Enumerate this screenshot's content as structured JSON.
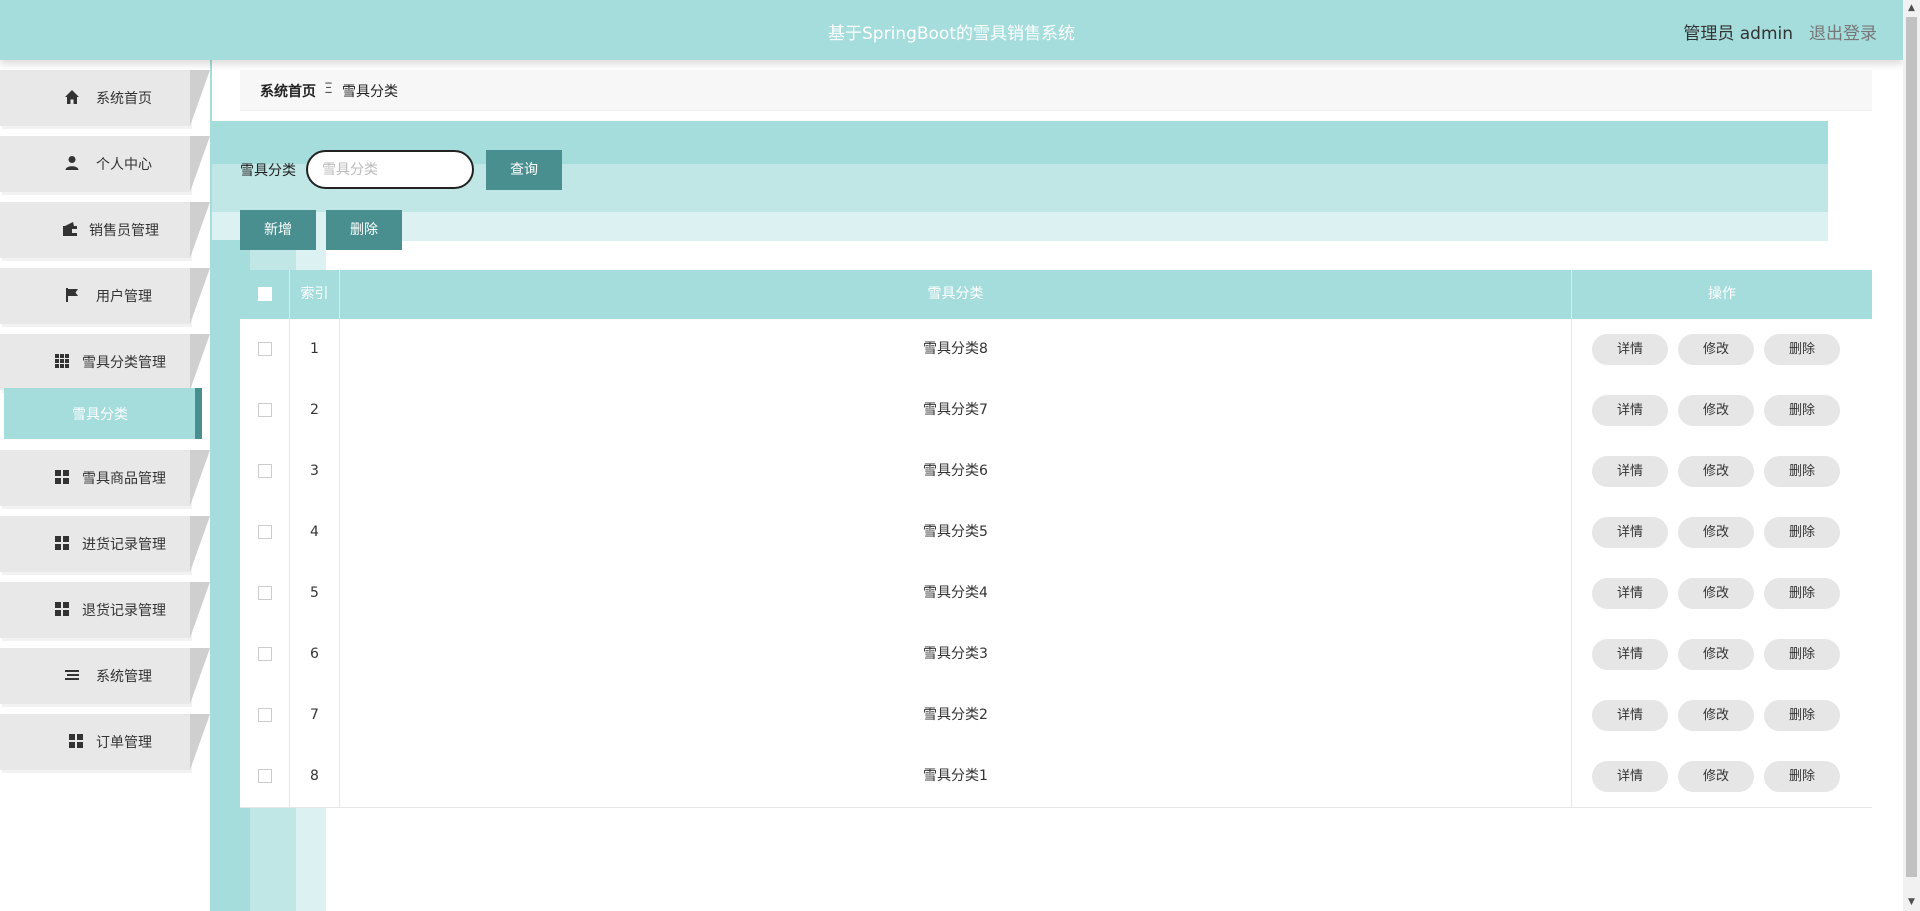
{
  "header": {
    "title": "基于SpringBoot的雪具销售系统",
    "user": "管理员 admin",
    "logout": "退出登录"
  },
  "sidebar": {
    "items": [
      {
        "label": "系统首页",
        "icon": "home-icon"
      },
      {
        "label": "个人中心",
        "icon": "person-icon"
      },
      {
        "label": "销售员管理",
        "icon": "wallet-icon"
      },
      {
        "label": "用户管理",
        "icon": "flag-icon"
      },
      {
        "label": "雪具分类管理",
        "icon": "grid-icon"
      },
      {
        "label": "雪具商品管理",
        "icon": "grid-icon"
      },
      {
        "label": "进货记录管理",
        "icon": "grid-icon"
      },
      {
        "label": "退货记录管理",
        "icon": "grid-icon"
      },
      {
        "label": "系统管理",
        "icon": "list-icon"
      },
      {
        "label": "订单管理",
        "icon": "grid-icon"
      }
    ],
    "active_sub": "雪具分类"
  },
  "breadcrumb": {
    "home": "系统首页",
    "separator": "Ξ",
    "current": "雪具分类"
  },
  "search": {
    "label": "雪具分类",
    "placeholder": "雪具分类",
    "query_button": "查询"
  },
  "toolbar": {
    "add_label": "新增",
    "delete_label": "删除"
  },
  "table": {
    "headers": {
      "index": "索引",
      "category": "雪具分类",
      "actions": "操作"
    },
    "rows": [
      {
        "index": "1",
        "category": "雪具分类8"
      },
      {
        "index": "2",
        "category": "雪具分类7"
      },
      {
        "index": "3",
        "category": "雪具分类6"
      },
      {
        "index": "4",
        "category": "雪具分类5"
      },
      {
        "index": "5",
        "category": "雪具分类4"
      },
      {
        "index": "6",
        "category": "雪具分类3"
      },
      {
        "index": "7",
        "category": "雪具分类2"
      },
      {
        "index": "8",
        "category": "雪具分类1"
      }
    ],
    "row_actions": {
      "detail": "详情",
      "edit": "修改",
      "delete": "删除"
    }
  },
  "colors": {
    "primary": "#a5dcdc",
    "accent": "#4a8f8f",
    "menu_bg": "#e8e8e8"
  }
}
